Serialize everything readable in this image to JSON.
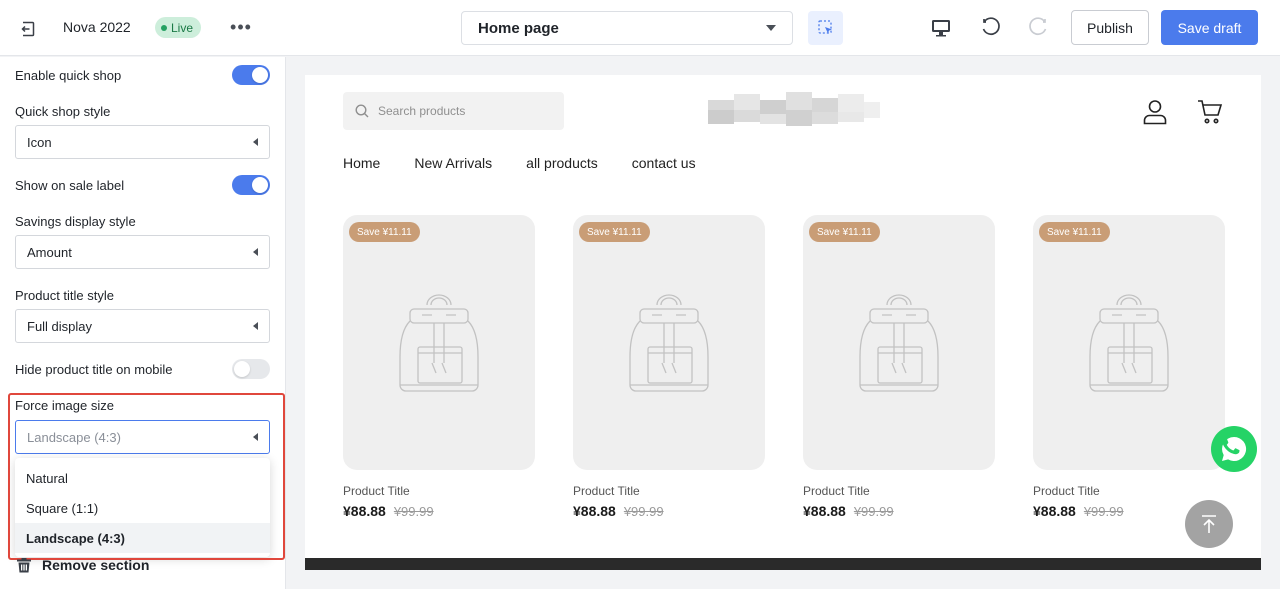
{
  "topbar": {
    "store_name": "Nova 2022",
    "live_label": "Live",
    "more_label": "•••",
    "page_select_value": "Home page",
    "publish_label": "Publish",
    "save_draft_label": "Save draft",
    "accent_color": "#4b7bec"
  },
  "panel": {
    "quick_shop": {
      "label": "Enable quick shop",
      "enabled": true
    },
    "quick_shop_style": {
      "label": "Quick shop style",
      "value": "Icon"
    },
    "sale_label": {
      "label": "Show on sale label",
      "enabled": true
    },
    "savings_style": {
      "label": "Savings display style",
      "value": "Amount"
    },
    "product_title_style": {
      "label": "Product title style",
      "value": "Full display"
    },
    "hide_title_mobile": {
      "label": "Hide product title on mobile",
      "enabled": false
    },
    "force_image_size": {
      "label": "Force image size",
      "value": "Landscape (4:3)",
      "options": [
        "Natural",
        "Square (1:1)",
        "Landscape (4:3)"
      ],
      "selected_option": "Landscape (4:3)"
    },
    "remove_section_label": "Remove section"
  },
  "preview": {
    "search_placeholder": "Search products",
    "nav": [
      "Home",
      "New Arrivals",
      "all products",
      "contact us"
    ],
    "products": [
      {
        "badge": "Save ¥11.11",
        "title": "Product Title",
        "price": "¥88.88",
        "compare_price": "¥99.99"
      },
      {
        "badge": "Save ¥11.11",
        "title": "Product Title",
        "price": "¥88.88",
        "compare_price": "¥99.99"
      },
      {
        "badge": "Save ¥11.11",
        "title": "Product Title",
        "price": "¥88.88",
        "compare_price": "¥99.99"
      },
      {
        "badge": "Save ¥11.11",
        "title": "Product Title",
        "price": "¥88.88",
        "compare_price": "¥99.99"
      }
    ],
    "badge_color": "#c99d76",
    "whatsapp_color": "#25d366"
  }
}
